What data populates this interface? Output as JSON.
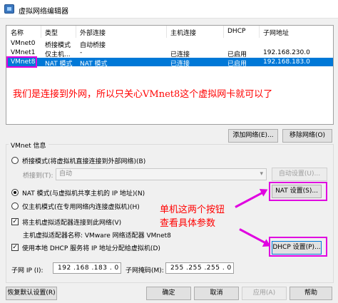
{
  "window": {
    "title": "虚拟网络编辑器"
  },
  "table": {
    "headers": [
      "名称",
      "类型",
      "外部连接",
      "主机连接",
      "DHCP",
      "子网地址"
    ],
    "rows": [
      [
        "VMnet0",
        "桥接模式",
        "自动桥接",
        "",
        "",
        ""
      ],
      [
        "VMnet1",
        "仅主机...",
        "-",
        "已连接",
        "已启用",
        "192.168.230.0"
      ],
      [
        "VMnet8",
        "NAT 模式",
        "NAT 模式",
        "已连接",
        "已启用",
        "192.168.183.0"
      ]
    ],
    "selected_row": 2
  },
  "annotations": {
    "top": "我们是连接到外网，所以只关心VMnet8这个虚拟网卡就可以了",
    "buttons_line1": "单机这两个按钮",
    "buttons_line2": "查看具体参数",
    "color": "#ff0000",
    "highlight_color": "#e000e0"
  },
  "list_buttons": {
    "add": "添加网络(E)...",
    "remove": "移除网络(O)"
  },
  "vmnet_info": {
    "legend": "VMnet 信息",
    "bridge_radio": "桥接模式(将虚拟机直接连接到外部网络)(B)",
    "bridge_to_label": "桥接到(T):",
    "bridge_to_value": "自动",
    "auto_settings": "自动设置(U)...",
    "nat_radio": "NAT 模式(与虚拟机共享主机的 IP 地址)(N)",
    "nat_settings": "NAT 设置(S)...",
    "hostonly_radio": "仅主机模式(在专用网络内连接虚拟机)(H)",
    "host_adapter_check": "将主机虚拟适配器连接到此网络(V)",
    "host_adapter_name": "主机虚拟适配器名称: VMware 网络适配器 VMnet8",
    "dhcp_check": "使用本地 DHCP 服务将 IP 地址分配给虚拟机(D)",
    "dhcp_settings": "DHCP 设置(P)...",
    "subnet_ip_label": "子网 IP (I):",
    "subnet_ip_value": "192 .168 .183 . 0",
    "subnet_mask_label": "子网掩码(M):",
    "subnet_mask_value": "255 .255 .255 . 0"
  },
  "footer": {
    "restore": "恢复默认设置(R)",
    "ok": "确定",
    "cancel": "取消",
    "apply": "应用(A)",
    "help": "帮助"
  }
}
